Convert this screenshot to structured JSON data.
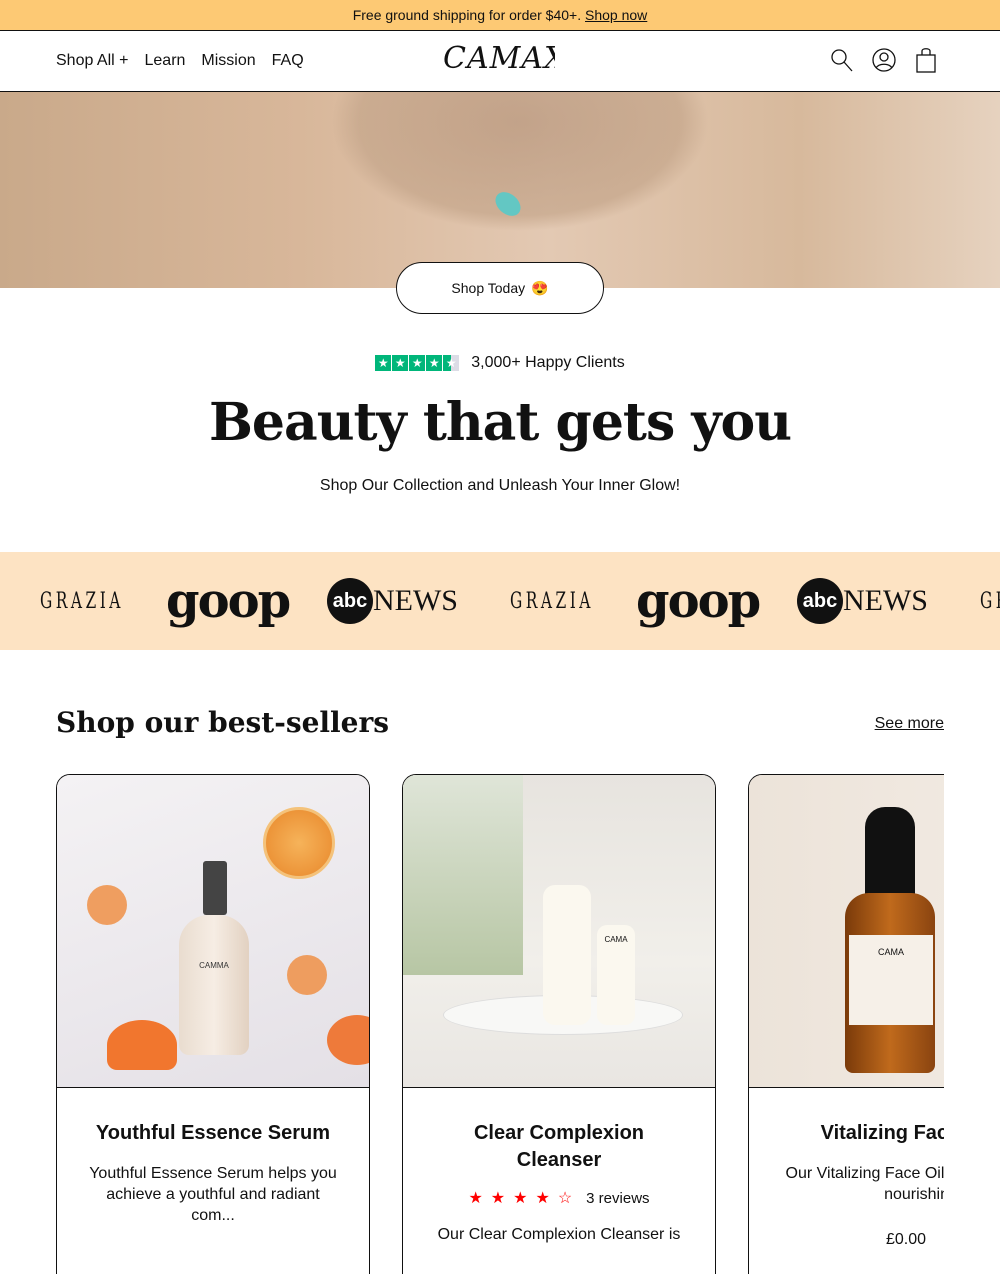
{
  "announcement": {
    "text": "Free ground shipping for order $40+.",
    "link": "Shop now"
  },
  "header": {
    "logo": "CAMAX",
    "nav": [
      "Shop All +",
      "Learn",
      "Mission",
      "FAQ"
    ],
    "icons": [
      "search-icon",
      "account-icon",
      "cart-icon"
    ]
  },
  "hero": {
    "button": "Shop Today",
    "emoji": "😍"
  },
  "rating": {
    "stars": 4.5,
    "text": "3,000+ Happy Clients",
    "color": "#00b67a"
  },
  "headline": "Beauty that gets you",
  "subheadline": "Shop Our Collection and Unleash Your Inner Glow!",
  "press": {
    "logos": [
      "GRAZIA",
      "goop",
      "abcNEWS",
      "GRAZIA",
      "goop",
      "abcNEWS",
      "GRAZIA"
    ],
    "background": "#fde3c3"
  },
  "bestsellers": {
    "title": "Shop our best-sellers",
    "see_more": "See more",
    "products": [
      {
        "name": "Youthful Essence Serum",
        "description": "Youthful Essence Serum helps you achieve a youthful and radiant com...",
        "label": "CAMMA"
      },
      {
        "name": "Clear Complexion Cleanser",
        "rating": 4,
        "reviews": "3 reviews",
        "description": "Our Clear Complexion Cleanser is",
        "label": "CAMA"
      },
      {
        "name": "Vitalizing Face Oil",
        "description": "Our Vitalizing Face Oil is natural, skin-nourishing",
        "price": "£0.00",
        "label": "CAMA"
      }
    ]
  }
}
